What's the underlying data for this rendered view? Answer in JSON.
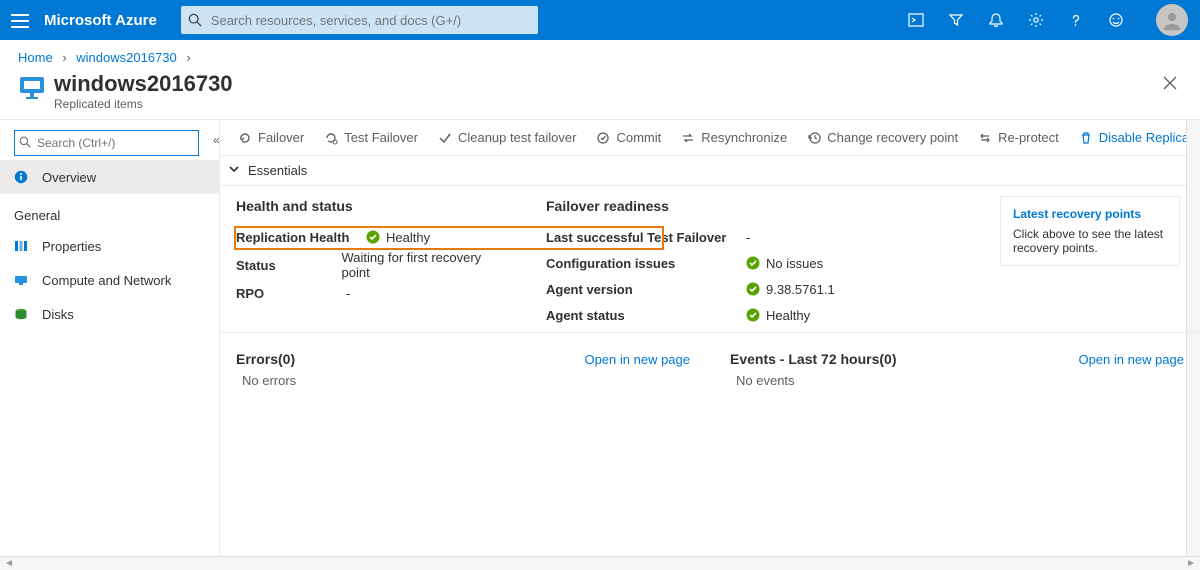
{
  "brand": "Microsoft Azure",
  "search_placeholder": "Search resources, services, and docs (G+/)",
  "breadcrumb": {
    "home": "Home",
    "item": "windows2016730"
  },
  "page": {
    "title": "windows2016730",
    "subtitle": "Replicated items"
  },
  "sidebar": {
    "search_placeholder": "Search (Ctrl+/)",
    "overview": "Overview",
    "general_group": "General",
    "items": [
      "Properties",
      "Compute and Network",
      "Disks"
    ]
  },
  "commands": {
    "failover": "Failover",
    "test_failover": "Test Failover",
    "cleanup": "Cleanup test failover",
    "commit": "Commit",
    "resync": "Resynchronize",
    "change_rp": "Change recovery point",
    "reprotect": "Re-protect",
    "disable": "Disable Replication"
  },
  "essentials_label": "Essentials",
  "health": {
    "heading": "Health and status",
    "rows": {
      "rep_health_k": "Replication Health",
      "rep_health_v": "Healthy",
      "status_k": "Status",
      "status_v": "Waiting for first recovery point",
      "rpo_k": "RPO",
      "rpo_v": "-"
    }
  },
  "readiness": {
    "heading": "Failover readiness",
    "rows": {
      "last_tf_k": "Last successful Test Failover",
      "last_tf_v": "-",
      "conf_k": "Configuration issues",
      "conf_v": "No issues",
      "agent_ver_k": "Agent version",
      "agent_ver_v": "9.38.5761.1",
      "agent_status_k": "Agent status",
      "agent_status_v": "Healthy"
    }
  },
  "tip": {
    "title": "Latest recovery points",
    "body": "Click above to see the latest recovery points."
  },
  "lower": {
    "errors_title": "Errors(0)",
    "errors_none": "No errors",
    "events_title": "Events - Last 72 hours(0)",
    "events_none": "No events",
    "open_link": "Open in new page"
  }
}
